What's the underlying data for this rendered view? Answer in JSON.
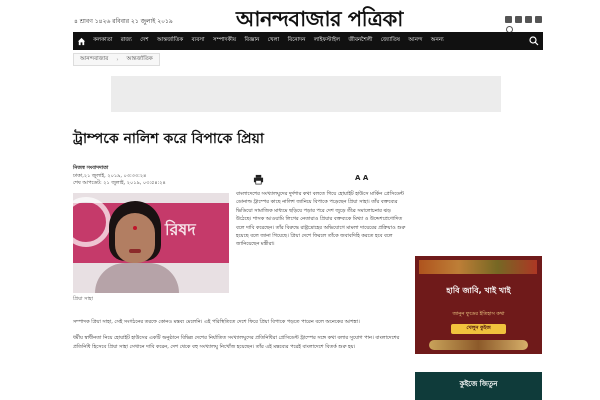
{
  "header": {
    "date": "৪ শ্রাবণ ১৪২৬ রবিবার ২১ জুলাই ২০১৯",
    "masthead": "আনন্দবাজার পত্রিকা"
  },
  "nav": {
    "items": [
      "কলকাতা",
      "রাজ্য",
      "দেশ",
      "আন্তর্জাতিক",
      "ব্যবসা",
      "সম্পাদকীয়",
      "বিজ্ঞান",
      "খেলা",
      "বিনোদন",
      "লাইফস্টাইল",
      "জীবনশৈলী",
      "জ্যোতিষ",
      "আনন্দ",
      "অনন্য"
    ]
  },
  "breadcrumb": [
    "আনন্দবাজার",
    "আন্তর্জাতিক"
  ],
  "article": {
    "headline": "ট্রাম্পকে নালিশ করে বিপাকে প্রিয়া",
    "author": "নিজস্ব সংবাদদাতা",
    "location": "ঢাকা,২১ জুলাই, ২০১৯, ০৩:৩৩:২৪",
    "updated": "শেষ আপডেট: ২১ জুলাই, ২০১৯, ০৩:৫৪:২৪",
    "font_control": "A A",
    "caption": "প্রিয়া সাহা",
    "column_text": "বাংলাদেশের সংখ্যালঘুদের দুর্দশার কথা বলতে গিয়ে হোয়াইট হাউসে মার্কিন প্রেসিডেন্ট ডোনাল্ড ট্রাম্পের কাছে নালিশ জানিয়ে বিপাকে পড়েছেন প্রিয়া সাহা। তাঁর বক্তব্যের ভিডিয়ো সামাজিক মাধ্যমে ছড়িয়ে পড়ার পরে দেশ জুড়ে তীব্র সমালোচনার ঝড় উঠেছে। শাসক আওয়ামি লিগের নেতারাও প্রিয়ার বক্তব্যকে মিথ্যা ও উদ্দেশ্যপ্রণোদিত বলে দাবি করেছেন। তাঁর বিরুদ্ধে রাষ্ট্রদ্রোহের অভিযোগে মামলা দায়েরের প্রক্রিয়াও শুরু হয়েছে বলে জানা গিয়েছে। প্রিয়া দেশে ফিরলে তাঁকে জবাবদিহি করতে হবে বলে জানিয়েছেন মন্ত্রীরা।",
    "full_text_1": "সম্পাদক প্রিয়া সাহা, সেই সংগঠনের তরফে কোনও মন্তব্য মেলেনি। এই পরিস্থিতিতে দেশে ফিরে প্রিয়া বিপাকে পড়তে পারেন বলে অনেকের আশঙ্কা।",
    "full_text_2": "ধর্মীয় স্বাধীনতা নিয়ে হোয়াইট হাউসের একটি অনুষ্ঠানে বিভিন্ন দেশের নির্যাতিত সংখ্যালঘুদের প্রতিনিধিরা প্রেসিডেন্ট ট্রাম্পের সঙ্গে কথা বলার সুযোগ পান। বাংলাদেশের প্রতিনিধি হিসেবে প্রিয়া সাহা সেখানে দাবি করেন, দেশ থেকে বহু সংখ্যালঘু নিখোঁজ হয়েছেন। তাঁর এই মন্তব্যের পরেই বাংলাদেশে বিতর্ক শুরু হয়।"
  },
  "ads": {
    "sidebar_title": "হাবি জাবি, খাই খাই",
    "sidebar_sub": "জানুন ফুডের ইতিহাস কথা",
    "sidebar_button": "খেলুন কুইজ",
    "sidebar2_title": "কুইজে জিতুন"
  }
}
